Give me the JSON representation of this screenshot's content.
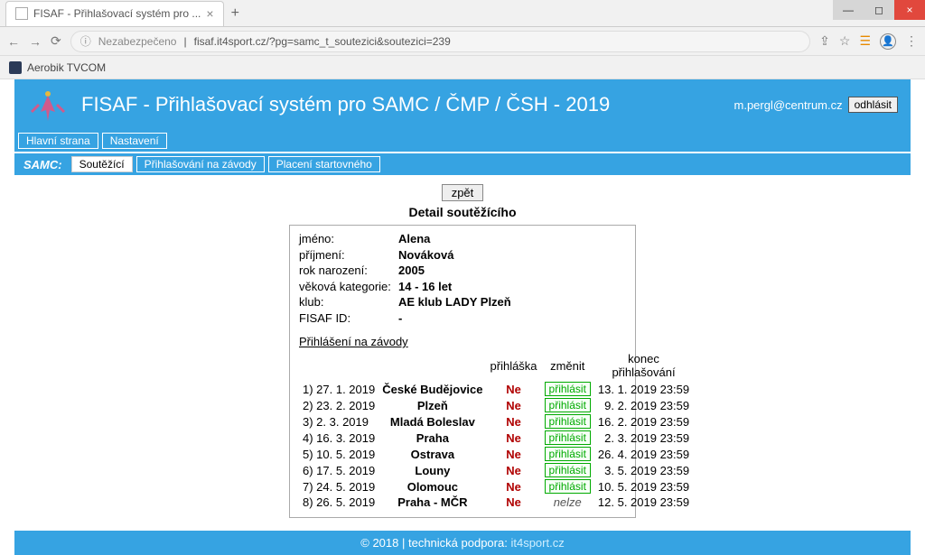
{
  "browser": {
    "tab_title": "FISAF - Přihlašovací systém pro ...",
    "insecure_label": "Nezabezpečeno",
    "url": "fisaf.it4sport.cz/?pg=samc_t_soutezici&soutezici=239",
    "bookmark_label": "Aerobik TVCOM"
  },
  "header": {
    "title": "FISAF - Přihlašovací systém pro SAMC / ČMP / ČSH - 2019",
    "user_email": "m.pergl@centrum.cz",
    "logout_label": "odhlásit"
  },
  "nav": {
    "main": [
      "Hlavní strana",
      "Nastavení"
    ],
    "samc_label": "SAMC:",
    "samc_tabs": [
      "Soutěžící",
      "Přihlašování na závody",
      "Placení startovného"
    ],
    "active_index": 0
  },
  "content": {
    "back_label": "zpět",
    "detail_title": "Detail soutěžícího",
    "info_labels": {
      "name": "jméno:",
      "surname": "příjmení:",
      "birth": "rok narození:",
      "agecat": "věková kategorie:",
      "club": "klub:",
      "fisafid": "FISAF ID:"
    },
    "info": {
      "name": "Alena",
      "surname": "Nováková",
      "birth": "2005",
      "agecat": "14 - 16 let",
      "club": "AE klub LADY Plzeň",
      "fisafid": "-"
    },
    "registrations_link": "Přihlášení na závody",
    "headers": {
      "app": "přihláška",
      "change": "změnit",
      "deadline": "konec přihlašování"
    },
    "btn_register": "přihlásit",
    "nelze": "nelze",
    "rows": [
      {
        "idx": "1)",
        "date": "27. 1. 2019",
        "place": "České Budějovice",
        "app": "Ne",
        "change": true,
        "deadline": "13. 1. 2019 23:59"
      },
      {
        "idx": "2)",
        "date": "23. 2. 2019",
        "place": "Plzeň",
        "app": "Ne",
        "change": true,
        "deadline": "9. 2. 2019 23:59"
      },
      {
        "idx": "3)",
        "date": "2. 3. 2019",
        "place": "Mladá Boleslav",
        "app": "Ne",
        "change": true,
        "deadline": "16. 2. 2019 23:59"
      },
      {
        "idx": "4)",
        "date": "16. 3. 2019",
        "place": "Praha",
        "app": "Ne",
        "change": true,
        "deadline": "2. 3. 2019 23:59"
      },
      {
        "idx": "5)",
        "date": "10. 5. 2019",
        "place": "Ostrava",
        "app": "Ne",
        "change": true,
        "deadline": "26. 4. 2019 23:59"
      },
      {
        "idx": "6)",
        "date": "17. 5. 2019",
        "place": "Louny",
        "app": "Ne",
        "change": true,
        "deadline": "3. 5. 2019 23:59"
      },
      {
        "idx": "7)",
        "date": "24. 5. 2019",
        "place": "Olomouc",
        "app": "Ne",
        "change": true,
        "deadline": "10. 5. 2019 23:59"
      },
      {
        "idx": "8)",
        "date": "26. 5. 2019",
        "place": "Praha - MČR",
        "app": "Ne",
        "change": false,
        "deadline": "12. 5. 2019 23:59"
      }
    ]
  },
  "footer": {
    "copyright": "© 2018 | technická podpora:",
    "support": "it4sport.cz"
  }
}
